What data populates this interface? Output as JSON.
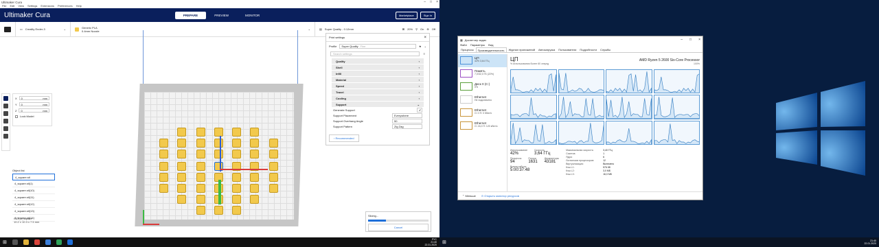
{
  "cura": {
    "window_title": "Ultimaker Cura",
    "menu": [
      "File",
      "Edit",
      "View",
      "Settings",
      "Extensions",
      "Preferences",
      "Help"
    ],
    "logo": "Ultimaker",
    "logo_sub": "Cura",
    "stages": [
      "PREPARE",
      "PREVIEW",
      "MONITOR"
    ],
    "marketplace": "Marketplace",
    "signin": "Sign in",
    "printer": "Creality Ender-3",
    "material": "Generic PLA",
    "nozzle": "0.4mm Nozzle",
    "quality": "Super Quality - 0.12mm",
    "infill": "20%",
    "support": "On",
    "adhesion": "Off",
    "move_fields": [
      {
        "axis": "X",
        "value": "0",
        "unit": "mm"
      },
      {
        "axis": "Y",
        "value": "0",
        "unit": "mm"
      },
      {
        "axis": "Z",
        "value": "0",
        "unit": "mm"
      }
    ],
    "lock_model": "Lock Model",
    "object_list_title": "Object list",
    "objects": [
      "4_square.stl",
      "4_square.stl(1)",
      "4_square.stl(10)",
      "4_square.stl(11)",
      "4_square.stl(12)",
      "4_square.stl(13)",
      "4_square.stl(14)"
    ],
    "object_name": "CE3_4_square",
    "object_dims": "10.2 x 10.3 x 7.5 mm",
    "print_settings_title": "Print settings",
    "profile_label": "Profile",
    "profile_value": "Super Quality",
    "profile_value_sub": "Fine",
    "search_placeholder": "Search settings",
    "categories": [
      "Quality",
      "Shell",
      "Infill",
      "Material",
      "Speed",
      "Travel",
      "Cooling",
      "Support"
    ],
    "support_settings": [
      {
        "label": "Generate Support",
        "value": "✔"
      },
      {
        "label": "Support Placement",
        "value": "Everywhere"
      },
      {
        "label": "Support Overhang Angle",
        "value": "50"
      },
      {
        "label": "Support Pattern",
        "value": "Zig Zag"
      }
    ],
    "recommended_button": "Recommended",
    "slicing_label": "Slicing...",
    "slicing_progress": 0.3,
    "cancel_button": "Cancel",
    "tray_time": "21:40",
    "tray_date": "22.01.2020",
    "tray_lang": "РУС"
  },
  "taskmgr": {
    "title": "Диспетчер задач",
    "menu": [
      "Файл",
      "Параметры",
      "Вид"
    ],
    "tabs": [
      "Процессы",
      "Производительность",
      "Журнал приложений",
      "Автозагрузка",
      "Пользователи",
      "Подробности",
      "Службы"
    ],
    "resources": [
      {
        "name": "ЦП",
        "sub": "42%  3,64 ГГц"
      },
      {
        "name": "Память",
        "sub": "7,0/32,0 ГБ (22%)"
      },
      {
        "name": "Диск 0 (C:)",
        "sub": "0%"
      },
      {
        "name": "Ethernet",
        "sub": "Не подключено"
      },
      {
        "name": "Ethernet",
        "sub": "О: 0  П: 0 Кбит/с"
      },
      {
        "name": "Ethernet",
        "sub": "О: 24,0  П: 120 кбит/с"
      }
    ],
    "cpu_title": "ЦП",
    "cpu_model": "AMD Ryzen 5 2600 Six-Core Processor",
    "graph_caption": "% использования более 60 секунд",
    "graph_max": "100%",
    "usage_label": "Использование",
    "usage_value": "42%",
    "speed_label": "Скорость",
    "speed_value": "3,64 ГГц",
    "processes_label": "Процессы",
    "processes_value": "94",
    "threads_label": "Потоки",
    "threads_value": "1631",
    "handles_label": "Дескрипторы",
    "handles_value": "43181",
    "uptime_label": "Время работы",
    "uptime_value": "5:00:37:48",
    "details": [
      {
        "k": "Максимальная скорость:",
        "v": "3,40 ГГц"
      },
      {
        "k": "Сокетов:",
        "v": "1"
      },
      {
        "k": "Ядра:",
        "v": "6"
      },
      {
        "k": "Логических процессоров:",
        "v": "12"
      },
      {
        "k": "Виртуализация:",
        "v": "Включено"
      },
      {
        "k": "Кэш L1:",
        "v": "576 КБ"
      },
      {
        "k": "Кэш L2:",
        "v": "3,0 МБ"
      },
      {
        "k": "Кэш L3:",
        "v": "16,0 МБ"
      }
    ],
    "fewer_details": "Меньше",
    "open_resmon": "Открыть монитор ресурсов",
    "tray_time": "21:40",
    "tray_date": "22.01.2020"
  }
}
